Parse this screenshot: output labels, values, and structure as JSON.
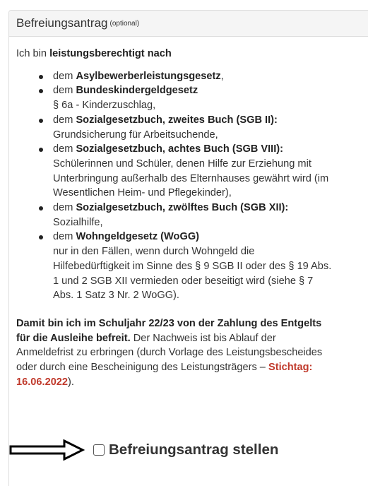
{
  "panel": {
    "title": "Befreiungsantrag",
    "title_small": "(optional)"
  },
  "intro": {
    "prefix": "Ich bin ",
    "bold": "leistungsberechtigt nach"
  },
  "items": [
    {
      "line1_prefix": "dem ",
      "line1_bold": "Asylbewerberleistungsgesetz",
      "line1_suffix": ",",
      "rest": []
    },
    {
      "line1_prefix": "dem ",
      "line1_bold": "Bundeskindergeldgesetz",
      "line1_suffix": "",
      "rest": [
        "§ 6a - Kinderzuschlag,"
      ]
    },
    {
      "line1_prefix": "dem ",
      "line1_bold": "Sozialgesetzbuch, zweites Buch (SGB II):",
      "line1_suffix": "",
      "rest": [
        "Grundsicherung für Arbeitsuchende,"
      ]
    },
    {
      "line1_prefix": "dem ",
      "line1_bold": "Sozialgesetzbuch, achtes Buch (SGB VIII):",
      "line1_suffix": "",
      "rest": [
        "Schülerinnen und Schüler, denen Hilfe zur Erziehung mit",
        "Unterbringung außerhalb des Elternhauses gewährt wird (im",
        "Wesentlichen Heim- und Pflegekinder),"
      ]
    },
    {
      "line1_prefix": "dem ",
      "line1_bold": "Sozialgesetzbuch, zwölftes Buch (SGB XII):",
      "line1_suffix": "",
      "rest": [
        "Sozialhilfe,"
      ]
    },
    {
      "line1_prefix": "dem ",
      "line1_bold": "Wohngeldgesetz (WoGG)",
      "line1_suffix": "",
      "rest": [
        "nur in den Fällen, wenn durch Wohngeld die",
        "Hilfebedürftigkeit im Sinne des § 9 SGB II oder des § 19 Abs.",
        "1 und 2 SGB XII vermieden oder beseitigt wird (siehe § 7",
        "Abs. 1 Satz 3 Nr. 2 WoGG)."
      ]
    }
  ],
  "closing": {
    "bold_line1": "Damit bin ich im Schuljahr 22/23 von der Zahlung des Entgelts",
    "bold_line2": "für die Ausleihe befreit.",
    "text_line2": " Der Nachweis ist bis Ablauf der",
    "line3": "Anmeldefrist zu erbringen (durch Vorlage des Leistungsbescheides",
    "line4_prefix": "oder durch eine Bescheinigung des Leistungsträgers – ",
    "deadline_label": "Stichtag:",
    "deadline_date": "16.06.2022",
    "line5_suffix": ")."
  },
  "cta": {
    "checkbox_checked": false,
    "label": "Befreiungsantrag stellen"
  },
  "colors": {
    "accent_red": "#c0392b",
    "panel_heading_bg": "#f5f5f5",
    "text": "#333333"
  },
  "icons": {
    "arrow": "arrow-right-outline-icon",
    "bullet": "bullet-icon"
  }
}
